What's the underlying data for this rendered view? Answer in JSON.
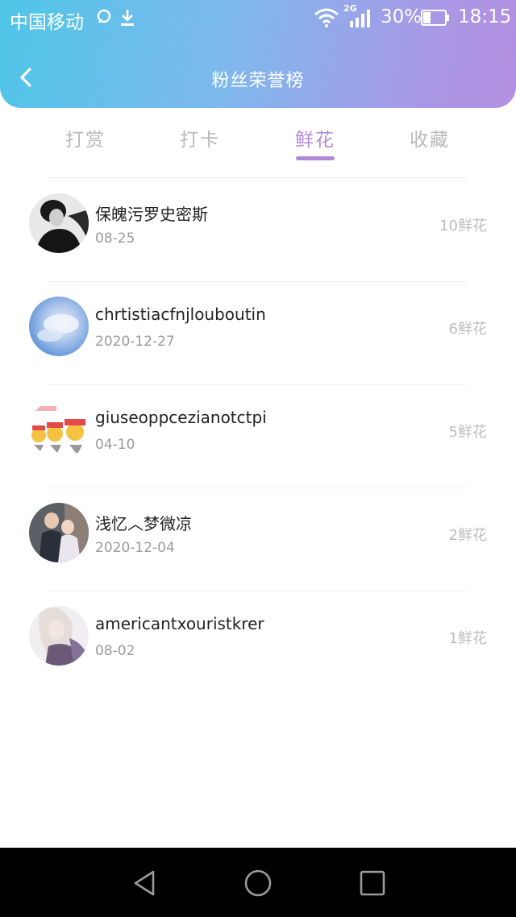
{
  "status_bar": {
    "carrier": "中国移动",
    "network": "2G",
    "battery": "30%",
    "time": "18:15",
    "icons": [
      "message-icon",
      "download-icon",
      "wifi-icon",
      "signal-icon",
      "battery-icon"
    ]
  },
  "header": {
    "title": "粉丝荣誉榜",
    "back_icon": "chevron-left-icon"
  },
  "tabs": [
    {
      "label": "打赏",
      "active": false
    },
    {
      "label": "打卡",
      "active": false
    },
    {
      "label": "鲜花",
      "active": true
    },
    {
      "label": "收藏",
      "active": false
    }
  ],
  "fans": [
    {
      "name": "保魄污罗史密斯",
      "date": "08-25",
      "count": "10鲜花",
      "avatar": "bw-portrait"
    },
    {
      "name": "chrtistiacfnjlouboutin",
      "date": "2020-12-27",
      "count": "6鲜花",
      "avatar": "blue-sky"
    },
    {
      "name": "giuseoppcezianotctpi",
      "date": "04-10",
      "count": "5鲜花",
      "avatar": "okay-emoji"
    },
    {
      "name": "浅忆︿梦微凉",
      "date": "2020-12-04",
      "count": "2鲜花",
      "avatar": "couple-photo"
    },
    {
      "name": "americantxouristkrer",
      "date": "08-02",
      "count": "1鲜花",
      "avatar": "blonde-portrait"
    }
  ],
  "system_nav": {
    "icons": [
      "back-triangle-icon",
      "home-circle-icon",
      "recents-square-icon"
    ]
  },
  "colors": {
    "accent": "#b08ad8",
    "header_start": "#4fc6e8",
    "header_end": "#b48fe0"
  }
}
